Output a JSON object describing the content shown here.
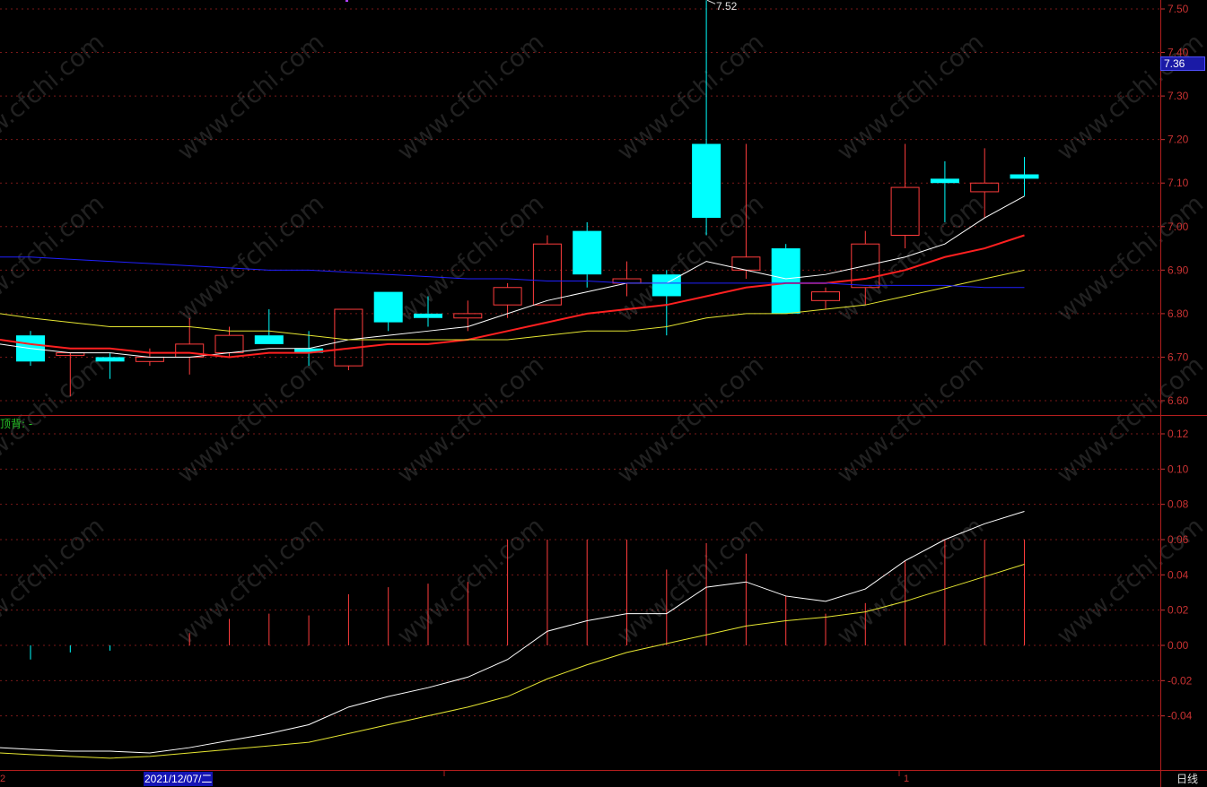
{
  "period_label": "日线",
  "indicator_title": "顶背: -",
  "cursor_date": "2021/12/07/二",
  "x_axis_left_label": "2",
  "x_axis_mid_label": "1",
  "current_price_label": "7.36",
  "max_price_label": "7.52",
  "watermark_text": "www.cfchi.com",
  "colors": {
    "up": "#ff3c3c",
    "down": "#00ffff",
    "grid": "#7a1818",
    "axis_label": "#c83232",
    "ma_white": "#ffffff",
    "ma_red": "#ff2020",
    "ma_yellow": "#e6e632",
    "ma_blue": "#2020ff",
    "indicator_fast": "#ffffff",
    "indicator_slow": "#e6e632",
    "macd_pos": "#ff3c3c",
    "macd_neg": "#00ffff"
  },
  "chart_data": [
    {
      "type": "candlestick",
      "title": "",
      "ylim": [
        6.55,
        7.55
      ],
      "y_ticks": [
        "7.50",
        "7.40",
        "7.30",
        "7.20",
        "7.10",
        "7.00",
        "6.90",
        "6.80",
        "6.70",
        "6.60"
      ],
      "candles": [
        {
          "o": 6.75,
          "h": 6.76,
          "l": 6.68,
          "c": 6.69
        },
        {
          "o": 6.71,
          "h": 6.71,
          "l": 6.61,
          "c": 6.71
        },
        {
          "o": 6.7,
          "h": 6.71,
          "l": 6.65,
          "c": 6.69
        },
        {
          "o": 6.69,
          "h": 6.72,
          "l": 6.68,
          "c": 6.7
        },
        {
          "o": 6.7,
          "h": 6.79,
          "l": 6.66,
          "c": 6.73
        },
        {
          "o": 6.71,
          "h": 6.77,
          "l": 6.7,
          "c": 6.75
        },
        {
          "o": 6.75,
          "h": 6.81,
          "l": 6.73,
          "c": 6.73
        },
        {
          "o": 6.72,
          "h": 6.76,
          "l": 6.68,
          "c": 6.71
        },
        {
          "o": 6.68,
          "h": 6.81,
          "l": 6.67,
          "c": 6.81
        },
        {
          "o": 6.85,
          "h": 6.85,
          "l": 6.76,
          "c": 6.78
        },
        {
          "o": 6.8,
          "h": 6.84,
          "l": 6.77,
          "c": 6.79
        },
        {
          "o": 6.79,
          "h": 6.83,
          "l": 6.76,
          "c": 6.8
        },
        {
          "o": 6.82,
          "h": 6.87,
          "l": 6.79,
          "c": 6.86
        },
        {
          "o": 6.82,
          "h": 6.98,
          "l": 6.82,
          "c": 6.96
        },
        {
          "o": 6.99,
          "h": 7.01,
          "l": 6.86,
          "c": 6.89
        },
        {
          "o": 6.87,
          "h": 6.92,
          "l": 6.84,
          "c": 6.88
        },
        {
          "o": 6.89,
          "h": 6.9,
          "l": 6.75,
          "c": 6.84
        },
        {
          "o": 7.19,
          "h": 7.52,
          "l": 6.98,
          "c": 7.02
        },
        {
          "o": 6.9,
          "h": 7.19,
          "l": 6.88,
          "c": 6.93
        },
        {
          "o": 6.95,
          "h": 6.96,
          "l": 6.8,
          "c": 6.8
        },
        {
          "o": 6.83,
          "h": 6.86,
          "l": 6.81,
          "c": 6.85
        },
        {
          "o": 6.86,
          "h": 6.99,
          "l": 6.82,
          "c": 6.96
        },
        {
          "o": 6.98,
          "h": 7.19,
          "l": 6.95,
          "c": 7.09
        },
        {
          "o": 7.11,
          "h": 7.15,
          "l": 7.01,
          "c": 7.1
        },
        {
          "o": 7.08,
          "h": 7.18,
          "l": 7.02,
          "c": 7.1
        },
        {
          "o": 7.12,
          "h": 7.16,
          "l": 7.07,
          "c": 7.11
        }
      ],
      "series": [
        {
          "values": [
            6.72,
            6.71,
            6.71,
            6.7,
            6.7,
            6.71,
            6.72,
            6.72,
            6.74,
            6.75,
            6.76,
            6.77,
            6.8,
            6.83,
            6.85,
            6.87,
            6.87,
            6.92,
            6.9,
            6.88,
            6.89,
            6.91,
            6.93,
            6.96,
            7.02,
            7.07
          ]
        },
        {
          "values": [
            6.73,
            6.72,
            6.72,
            6.71,
            6.71,
            6.7,
            6.71,
            6.71,
            6.72,
            6.73,
            6.73,
            6.74,
            6.76,
            6.78,
            6.8,
            6.81,
            6.82,
            6.84,
            6.86,
            6.87,
            6.87,
            6.88,
            6.9,
            6.93,
            6.95,
            6.98
          ]
        },
        {
          "values": [
            6.79,
            6.78,
            6.77,
            6.77,
            6.77,
            6.76,
            6.76,
            6.75,
            6.74,
            6.74,
            6.74,
            6.74,
            6.74,
            6.75,
            6.76,
            6.76,
            6.77,
            6.79,
            6.8,
            6.8,
            6.81,
            6.82,
            6.84,
            6.86,
            6.88,
            6.9
          ]
        },
        {
          "values": [
            6.93,
            6.925,
            6.92,
            6.915,
            6.91,
            6.905,
            6.9,
            6.9,
            6.895,
            6.89,
            6.885,
            6.88,
            6.88,
            6.875,
            6.875,
            6.87,
            6.87,
            6.87,
            6.87,
            6.87,
            6.87,
            6.865,
            6.865,
            6.865,
            6.86,
            6.86
          ]
        }
      ]
    },
    {
      "type": "bar+line",
      "title": "",
      "ylim": [
        -0.066,
        0.12
      ],
      "y_ticks": [
        "0.12",
        "0.10",
        "0.08",
        "0.06",
        "0.04",
        "0.02",
        "0.00",
        "-0.02",
        "-0.04"
      ],
      "bars": [
        -0.008,
        -0.004,
        -0.003,
        0.0,
        0.007,
        0.015,
        0.018,
        0.017,
        0.029,
        0.033,
        0.035,
        0.036,
        0.06,
        0.06,
        0.06,
        0.06,
        0.043,
        0.058,
        0.052,
        0.028,
        0.018,
        0.024,
        0.048,
        0.06,
        0.06,
        0.06
      ],
      "series": [
        {
          "values": [
            -0.059,
            -0.06,
            -0.06,
            -0.061,
            -0.058,
            -0.054,
            -0.05,
            -0.045,
            -0.035,
            -0.029,
            -0.024,
            -0.018,
            -0.008,
            0.008,
            0.014,
            0.018,
            0.018,
            0.033,
            0.036,
            0.028,
            0.025,
            0.032,
            0.048,
            0.06,
            0.069,
            0.076
          ]
        },
        {
          "values": [
            -0.062,
            -0.063,
            -0.064,
            -0.063,
            -0.061,
            -0.059,
            -0.057,
            -0.055,
            -0.05,
            -0.045,
            -0.04,
            -0.035,
            -0.029,
            -0.019,
            -0.011,
            -0.004,
            0.001,
            0.006,
            0.011,
            0.014,
            0.016,
            0.019,
            0.025,
            0.032,
            0.039,
            0.046
          ]
        }
      ]
    }
  ]
}
